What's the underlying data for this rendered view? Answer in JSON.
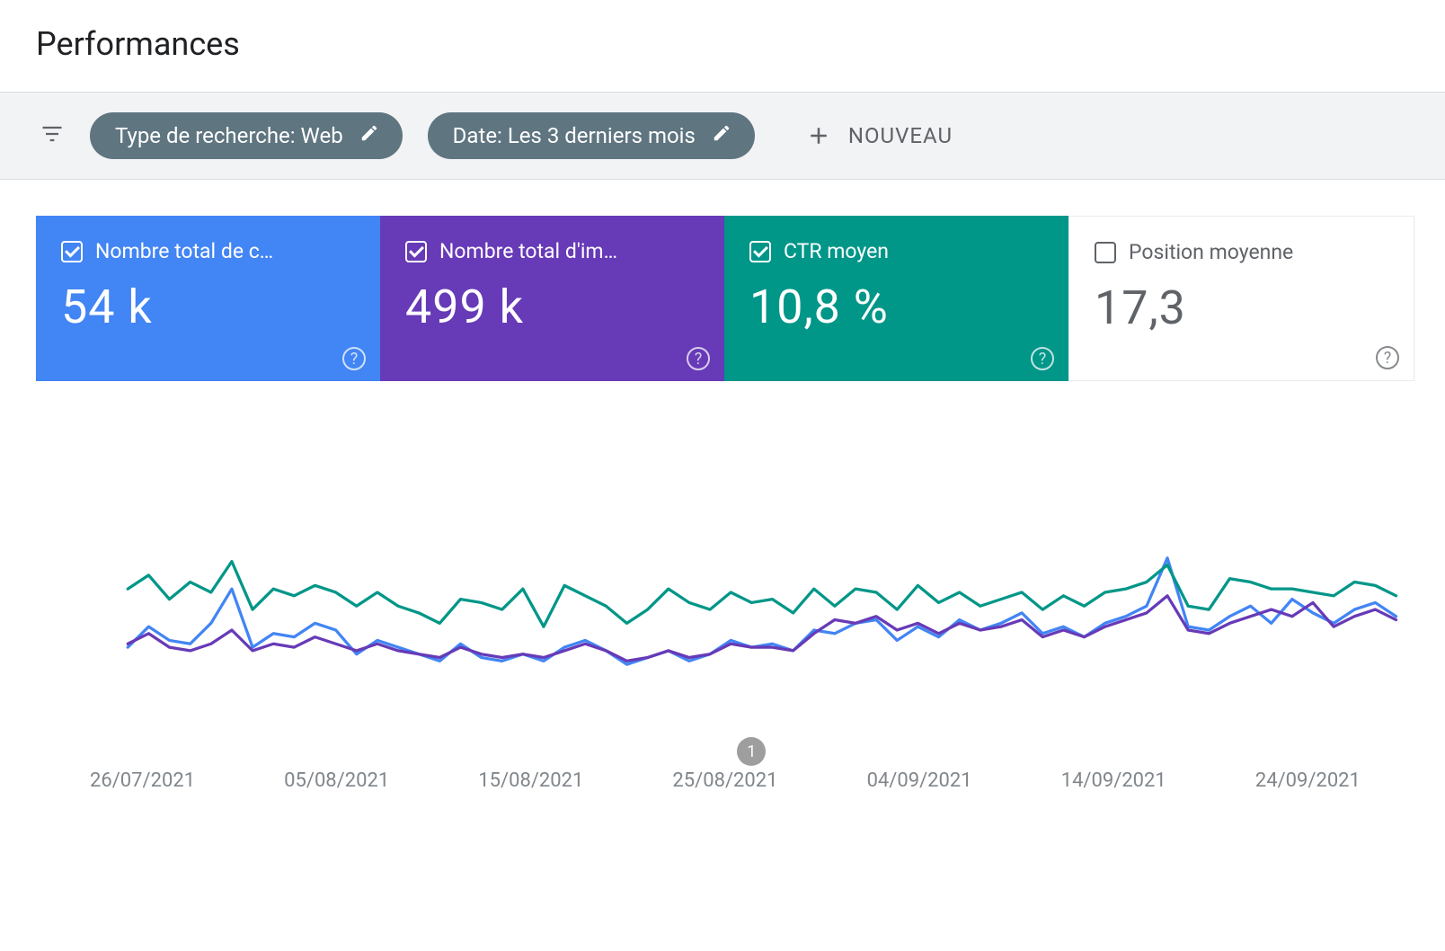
{
  "title": "Performances",
  "filters": {
    "search_type": "Type de recherche: Web",
    "date_range": "Date: Les 3 derniers mois",
    "new_label": "NOUVEAU"
  },
  "cards": {
    "clicks": {
      "label": "Nombre total de c…",
      "value": "54 k",
      "checked": true
    },
    "impressions": {
      "label": "Nombre total d'im…",
      "value": "499 k",
      "checked": true
    },
    "ctr": {
      "label": "CTR moyen",
      "value": "10,8 %",
      "checked": true
    },
    "position": {
      "label": "Position moyenne",
      "value": "17,3",
      "checked": false
    }
  },
  "milestone_label": "1",
  "chart_data": {
    "type": "line",
    "xlabel": "",
    "ylabel": "",
    "categories": [
      "26/07/2021",
      "05/08/2021",
      "15/08/2021",
      "25/08/2021",
      "04/09/2021",
      "14/09/2021",
      "24/09/2021"
    ],
    "series": [
      {
        "name": "Nombre total de clics",
        "color": "#4285f4",
        "values": [
          48,
          60,
          52,
          50,
          62,
          82,
          48,
          56,
          54,
          62,
          58,
          44,
          52,
          48,
          44,
          40,
          50,
          42,
          40,
          44,
          40,
          48,
          52,
          46,
          38,
          42,
          46,
          40,
          44,
          52,
          48,
          50,
          46,
          58,
          56,
          62,
          64,
          52,
          60,
          54,
          64,
          58,
          62,
          68,
          56,
          60,
          54,
          62,
          66,
          72,
          100,
          60,
          58,
          66,
          72,
          62,
          76,
          68,
          62,
          70,
          74,
          66
        ]
      },
      {
        "name": "Nombre total d'impressions",
        "color": "#673ab7",
        "values": [
          50,
          56,
          48,
          46,
          50,
          58,
          46,
          50,
          48,
          54,
          50,
          46,
          50,
          46,
          44,
          42,
          48,
          44,
          42,
          44,
          42,
          46,
          50,
          46,
          40,
          42,
          46,
          42,
          44,
          50,
          48,
          48,
          46,
          56,
          64,
          62,
          66,
          58,
          62,
          56,
          62,
          58,
          60,
          64,
          54,
          58,
          54,
          60,
          64,
          68,
          78,
          58,
          56,
          62,
          66,
          70,
          66,
          74,
          60,
          66,
          70,
          64
        ]
      },
      {
        "name": "CTR moyen",
        "color": "#009688",
        "values": [
          82,
          90,
          76,
          86,
          80,
          98,
          70,
          82,
          78,
          84,
          80,
          72,
          80,
          72,
          68,
          62,
          76,
          74,
          70,
          82,
          60,
          84,
          78,
          72,
          62,
          70,
          82,
          74,
          70,
          80,
          74,
          76,
          68,
          82,
          72,
          82,
          80,
          70,
          84,
          74,
          80,
          72,
          76,
          80,
          70,
          78,
          72,
          80,
          82,
          86,
          96,
          72,
          70,
          88,
          86,
          82,
          82,
          80,
          78,
          86,
          84,
          78
        ]
      }
    ],
    "ylim": [
      0,
      150
    ]
  }
}
